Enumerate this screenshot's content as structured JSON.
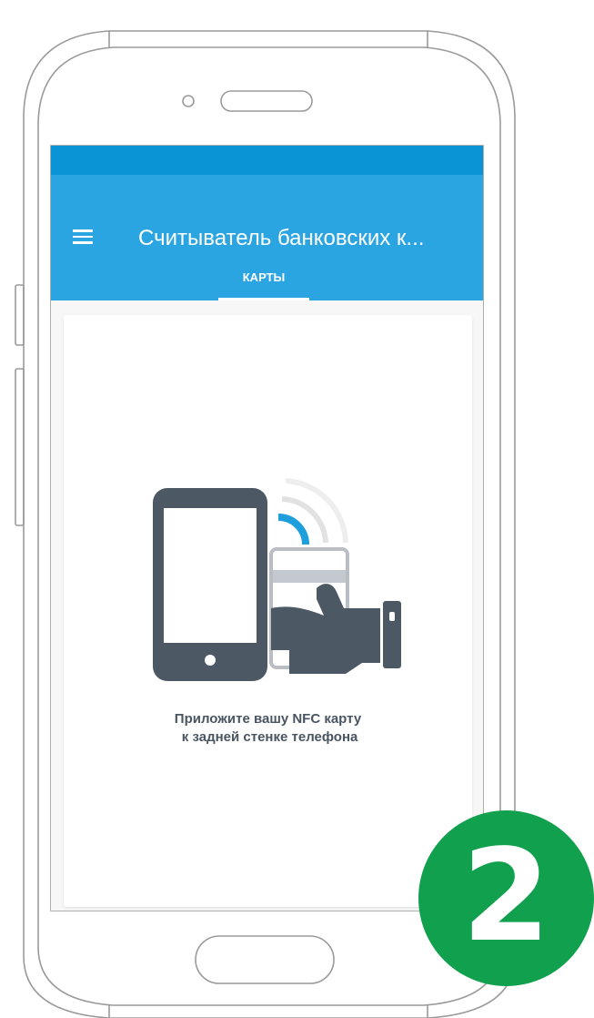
{
  "app": {
    "title": "Считыватель банковских к...",
    "tabs": [
      {
        "label": "КАРТЫ",
        "active": true
      }
    ]
  },
  "colors": {
    "status_bar": "#0a94d6",
    "app_bar": "#2aa5e2",
    "icon": "#4d5865",
    "nfc_accent": "#1e9fdb",
    "badge": "#11a14e"
  },
  "icons": {
    "menu": "hamburger-menu-icon",
    "illustration": "nfc-phone-card-icon"
  },
  "instruction": {
    "line1": "Приложите вашу NFC карту",
    "line2": " к задней стенке телефона"
  },
  "step": {
    "number": "2"
  }
}
